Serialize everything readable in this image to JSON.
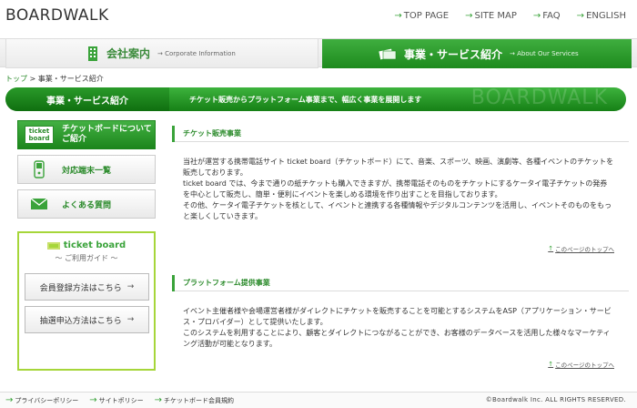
{
  "header": {
    "logo": "BOARDWALK",
    "nav": [
      {
        "label": "TOP PAGE"
      },
      {
        "label": "SITE MAP"
      },
      {
        "label": "FAQ"
      },
      {
        "label": "ENGLISH"
      }
    ]
  },
  "tabs": [
    {
      "label": "会社案内",
      "sub": "Corporate Information",
      "icon": "building-icon"
    },
    {
      "label": "事業・サービス紹介",
      "sub": "About Our Services",
      "icon": "tickets-icon"
    }
  ],
  "breadcrumb": {
    "home": "トップ",
    "sep": ">",
    "current": "事業・サービス紹介"
  },
  "banner": {
    "title": "事業・サービス紹介",
    "description": "チケット販売からプラットフォーム事業まで、幅広く事業を展開します",
    "watermark": "BOARDWALK"
  },
  "sidebar": {
    "items": [
      {
        "label": "チケットボードについてご紹介",
        "label_line1": "チケットボードについて",
        "label_line2": "ご紹介",
        "icon": "ticket-board-logo-icon"
      },
      {
        "label": "対応端末一覧",
        "icon": "mobile-phone-icon"
      },
      {
        "label": "よくある質問",
        "icon": "envelope-icon"
      }
    ],
    "guide": {
      "brand": "ticket board",
      "subtitle": "〜 ご利用ガイド 〜",
      "buttons": [
        {
          "label": "会員登録方法はこちら",
          "arrow": "→"
        },
        {
          "label": "抽選申込方法はこちら",
          "arrow": "→"
        }
      ]
    }
  },
  "sections": [
    {
      "title": "チケット販売事業",
      "paragraphs": [
        "当社が運営する携帯電話サイト ticket board（チケットボード）にて、音楽、スポーツ、映画、演劇等、各種イベントのチケットを販売しております。",
        "ticket board では、今まで通りの紙チケットも購入できますが、携帯電話そのものをチケットにするケータイ電子チケットの発券を中心として販売し、簡単・便利にイベントを楽しめる環境を作り出すことを目指しております。",
        "その他、ケータイ電子チケットを核として、イベントと連携する各種情報やデジタルコンテンツを活用し、イベントそのものをもっと楽しくしていきます。"
      ],
      "top_link": "このページのトップへ"
    },
    {
      "title": "プラットフォーム提供事業",
      "paragraphs": [
        "イベント主催者様や会場運営者様がダイレクトにチケットを販売することを可能とするシステムをASP（アプリケーション・サービス・プロバイダー）として提供いたします。",
        "このシステムを利用することにより、顧客とダイレクトにつながることができ、お客様のデータベースを活用した様々なマーケティング活動が可能となります。"
      ],
      "top_link": "このページのトップへ"
    }
  ],
  "footer": {
    "links": [
      {
        "label": "プライバシーポリシー"
      },
      {
        "label": "サイトポリシー"
      },
      {
        "label": "チケットボード会員規約"
      }
    ],
    "copyright": "©Boardwalk Inc. ALL RIGHTS RESERVED."
  },
  "colors": {
    "accent": "#3aa33a",
    "accent_dark": "#168016",
    "guide_border": "#a6d63a"
  }
}
